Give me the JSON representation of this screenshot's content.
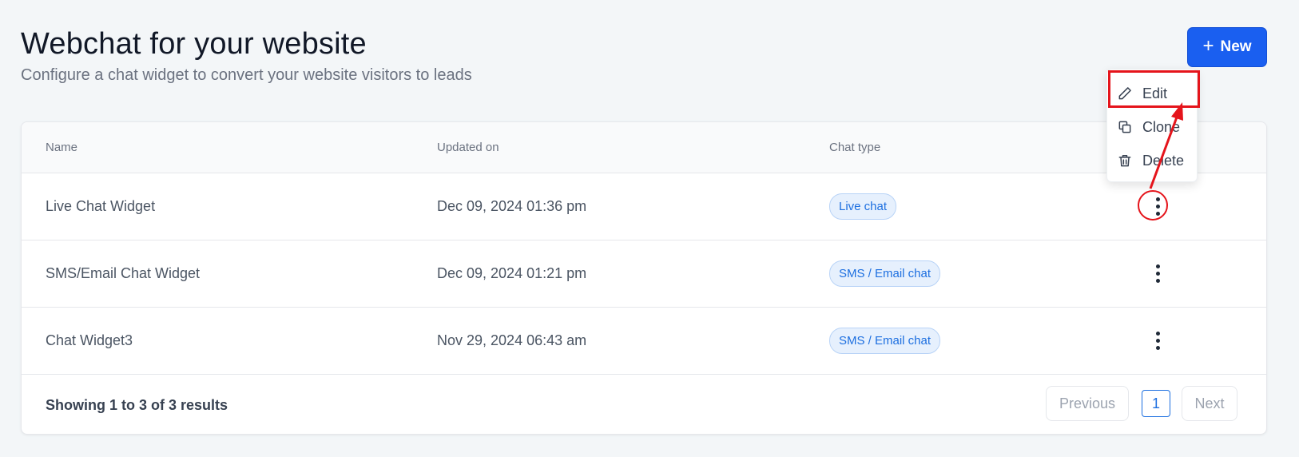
{
  "header": {
    "title": "Webchat for your website",
    "subtitle": "Configure a chat widget to convert your website visitors to leads"
  },
  "new_button": {
    "label": "New",
    "icon": "plus-icon"
  },
  "table": {
    "columns": [
      "Name",
      "Updated on",
      "Chat type"
    ],
    "rows": [
      {
        "name": "Live Chat Widget",
        "updated": "Dec 09, 2024 01:36 pm",
        "chat_type": "Live chat"
      },
      {
        "name": "SMS/Email Chat Widget",
        "updated": "Dec 09, 2024 01:21 pm",
        "chat_type": "SMS / Email chat"
      },
      {
        "name": "Chat Widget3",
        "updated": "Nov 29, 2024 06:43 am",
        "chat_type": "SMS / Email chat"
      }
    ]
  },
  "footer": {
    "showing": "Showing 1 to 3 of 3 results",
    "previous": "Previous",
    "page": "1",
    "next": "Next"
  },
  "menu": {
    "edit": "Edit",
    "clone": "Clone",
    "delete": "Delete"
  },
  "colors": {
    "primary": "#1a5ff0",
    "badge_bg": "#e6f0fd",
    "badge_text": "#1d6fe0",
    "highlight": "#e5141b"
  }
}
